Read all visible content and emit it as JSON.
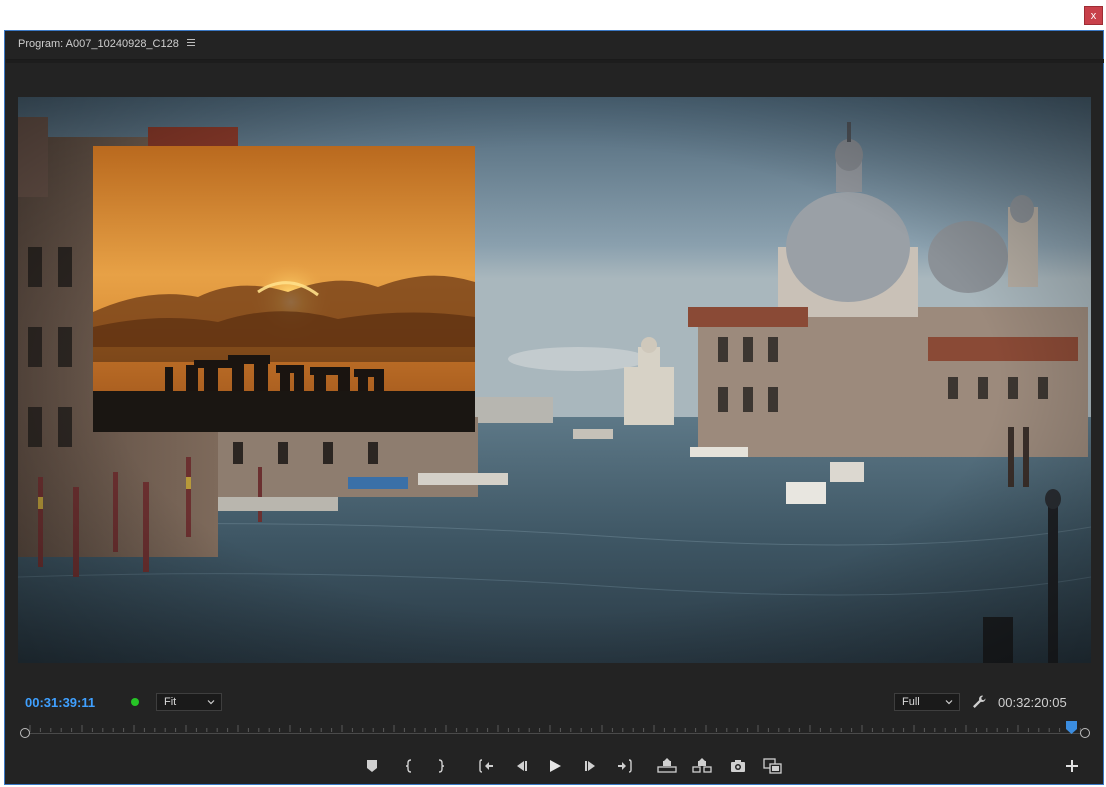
{
  "window": {
    "close_label": "x"
  },
  "panel": {
    "title": "Program: A007_10240928_C128",
    "menu_icon": "hamburger-menu-icon"
  },
  "viewer": {
    "main_image": "venice-grand-canal-santa-maria-della-salute",
    "overlay_image": "stonehenge-sunset-silhouette"
  },
  "controls": {
    "current_timecode": "00:31:39:11",
    "status_color": "#26c426",
    "zoom_level": "Fit",
    "resolution": "Full",
    "duration_timecode": "00:32:20:05",
    "settings_icon": "wrench-icon"
  },
  "timeline": {
    "playhead_position_fraction": 0.98,
    "playhead_color": "#3b8de0"
  },
  "transport": {
    "buttons": [
      {
        "name": "add-marker-button",
        "icon": "marker-icon"
      },
      {
        "name": "mark-in-button",
        "icon": "mark-in-icon"
      },
      {
        "name": "mark-out-button",
        "icon": "mark-out-icon"
      },
      {
        "name": "go-to-in-button",
        "icon": "go-to-in-icon"
      },
      {
        "name": "step-back-button",
        "icon": "step-back-icon"
      },
      {
        "name": "play-button",
        "icon": "play-icon"
      },
      {
        "name": "step-forward-button",
        "icon": "step-forward-icon"
      },
      {
        "name": "go-to-out-button",
        "icon": "go-to-out-icon"
      },
      {
        "name": "lift-button",
        "icon": "lift-icon"
      },
      {
        "name": "extract-button",
        "icon": "extract-icon"
      },
      {
        "name": "export-frame-button",
        "icon": "camera-icon"
      },
      {
        "name": "comparison-view-button",
        "icon": "comparison-view-icon"
      },
      {
        "name": "button-editor-button",
        "icon": "plus-icon"
      }
    ]
  },
  "colors": {
    "panel_bg": "#232323",
    "accent": "#3fa0ff",
    "panel_border": "#3b78c4"
  }
}
